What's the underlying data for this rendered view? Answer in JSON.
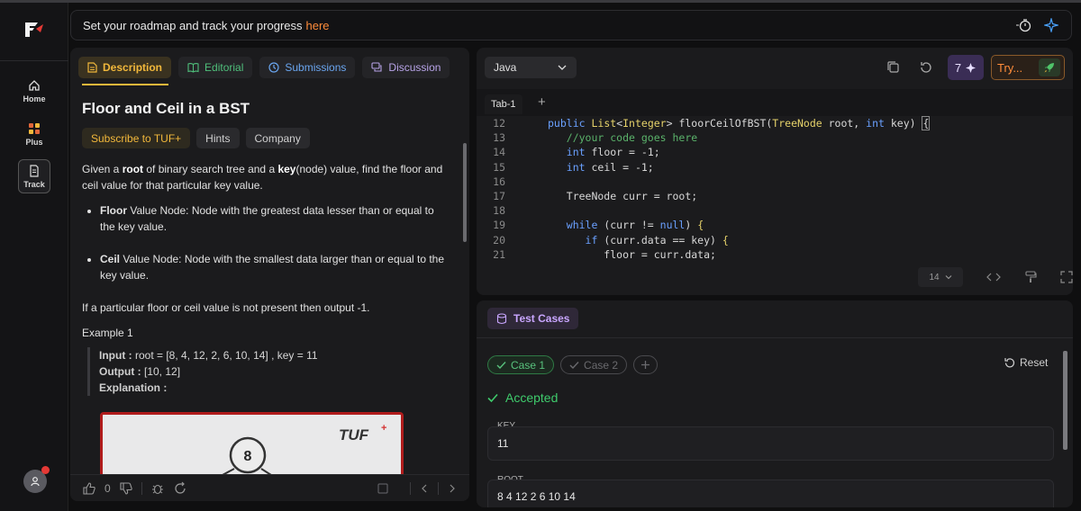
{
  "rail": {
    "items": [
      {
        "label": "Home",
        "icon": "home-icon"
      },
      {
        "label": "Plus",
        "icon": "plus-grid-icon"
      },
      {
        "label": "Track",
        "icon": "document-icon"
      }
    ]
  },
  "banner": {
    "text": "Set your roadmap and track your progress",
    "link": "here"
  },
  "left": {
    "tabs": [
      "Description",
      "Editorial",
      "Submissions",
      "Discussion"
    ],
    "title": "Floor and Ceil in a BST",
    "chips": [
      "Subscribe to TUF+",
      "Hints",
      "Company"
    ],
    "intro": {
      "a": "Given a ",
      "b1": "root",
      "c": " of binary search tree and a ",
      "b2": "key",
      "d": "(node) value, find the floor and ceil value for that particular key value."
    },
    "bullets": [
      {
        "bold": "Floor",
        "text": " Value Node: Node with the greatest data lesser than or equal to the key value."
      },
      {
        "bold": "Ceil",
        "text": " Value Node: Node with the smallest data larger than or equal to the key value."
      }
    ],
    "note": "If a particular floor or ceil value is not present then output -1.",
    "example_title": "Example 1",
    "example": {
      "input_label": "Input :",
      "input": " root = [8, 4, 12, 2, 6, 10, 14] , key = 11",
      "output_label": "Output :",
      "output": " [10, 12]",
      "expl_label": "Explanation :"
    },
    "image": {
      "logo": "TUF",
      "node": "8"
    },
    "footer": {
      "likes": "0"
    }
  },
  "editor": {
    "language": "Java",
    "stars": "7",
    "try_label": "Try...",
    "file_tab": "Tab-1",
    "font_size": "14",
    "lines": [
      {
        "n": "12",
        "t": "public List<Integer> floorCeilOfBST(TreeNode root, int key) {"
      },
      {
        "n": "13",
        "t": "   //your code goes here"
      },
      {
        "n": "14",
        "t": "   int floor = -1;"
      },
      {
        "n": "15",
        "t": "   int ceil = -1;"
      },
      {
        "n": "16",
        "t": ""
      },
      {
        "n": "17",
        "t": "   TreeNode curr = root;"
      },
      {
        "n": "18",
        "t": ""
      },
      {
        "n": "19",
        "t": "   while (curr != null) {"
      },
      {
        "n": "20",
        "t": "      if (curr.data == key) {"
      },
      {
        "n": "21",
        "t": "         floor = curr.data;"
      }
    ]
  },
  "tests": {
    "tab": "Test Cases",
    "cases": [
      "Case 1",
      "Case 2"
    ],
    "reset": "Reset",
    "status": "Accepted",
    "fields": [
      {
        "label": "KEY",
        "value": "11"
      },
      {
        "label": "ROOT",
        "value": "8 4 12 2 6 10 14"
      }
    ]
  }
}
